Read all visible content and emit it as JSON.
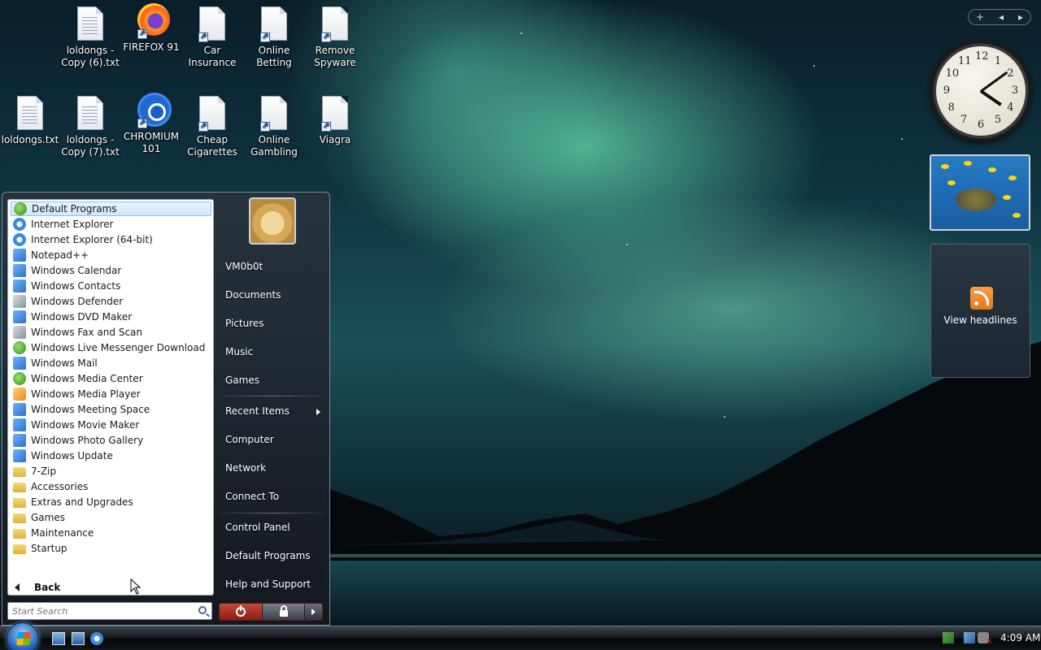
{
  "desktop": {
    "icons": [
      {
        "label": "loldongs - Copy (6).txt",
        "type": "txt"
      },
      {
        "label": "FIREFOX 91",
        "type": "firefox"
      },
      {
        "label": "Car Insurance",
        "type": "doc-shortcut"
      },
      {
        "label": "Online Betting",
        "type": "doc-shortcut"
      },
      {
        "label": "Remove Spyware",
        "type": "doc-shortcut"
      },
      {
        "label": "loldongs.txt",
        "type": "txt"
      },
      {
        "label": "loldongs - Copy (7).txt",
        "type": "txt"
      },
      {
        "label": "CHROMIUM 101",
        "type": "chromium"
      },
      {
        "label": "Cheap Cigarettes",
        "type": "doc-shortcut"
      },
      {
        "label": "Online Gambling",
        "type": "doc-shortcut"
      },
      {
        "label": "Viagra",
        "type": "doc-shortcut"
      }
    ]
  },
  "gadgets": {
    "bar": {
      "add": "+",
      "prev": "◂",
      "next": "▸"
    },
    "clock": {
      "numerals": [
        "12",
        "1",
        "2",
        "3",
        "4",
        "5",
        "6",
        "7",
        "8",
        "9",
        "10",
        "11"
      ],
      "hour": 4,
      "minute": 9
    },
    "feed": {
      "label": "View headlines",
      "icon": "rss-icon"
    }
  },
  "start_menu": {
    "programs": [
      {
        "label": "Default Programs",
        "icon": "green",
        "highlighted": true
      },
      {
        "label": "Internet Explorer",
        "icon": "ie"
      },
      {
        "label": "Internet Explorer (64-bit)",
        "icon": "ie"
      },
      {
        "label": "Notepad++",
        "icon": "app"
      },
      {
        "label": "Windows Calendar",
        "icon": "app"
      },
      {
        "label": "Windows Contacts",
        "icon": "app"
      },
      {
        "label": "Windows Defender",
        "icon": "grey"
      },
      {
        "label": "Windows DVD Maker",
        "icon": "app"
      },
      {
        "label": "Windows Fax and Scan",
        "icon": "grey"
      },
      {
        "label": "Windows Live Messenger Download",
        "icon": "green"
      },
      {
        "label": "Windows Mail",
        "icon": "app"
      },
      {
        "label": "Windows Media Center",
        "icon": "green"
      },
      {
        "label": "Windows Media Player",
        "icon": "orange"
      },
      {
        "label": "Windows Meeting Space",
        "icon": "app"
      },
      {
        "label": "Windows Movie Maker",
        "icon": "app"
      },
      {
        "label": "Windows Photo Gallery",
        "icon": "app"
      },
      {
        "label": "Windows Update",
        "icon": "app"
      },
      {
        "label": "7-Zip",
        "icon": "folder"
      },
      {
        "label": "Accessories",
        "icon": "folder"
      },
      {
        "label": "Extras and Upgrades",
        "icon": "folder"
      },
      {
        "label": "Games",
        "icon": "folder"
      },
      {
        "label": "Maintenance",
        "icon": "folder"
      },
      {
        "label": "Startup",
        "icon": "folder"
      }
    ],
    "back_label": "Back",
    "search": {
      "placeholder": "Start Search"
    },
    "user": {
      "name": "VM0b0t"
    },
    "right_items": {
      "documents": "Documents",
      "pictures": "Pictures",
      "music": "Music",
      "games": "Games",
      "recent_items": "Recent Items",
      "computer": "Computer",
      "network": "Network",
      "connect_to": "Connect To",
      "control_panel": "Control Panel",
      "default_programs": "Default Programs",
      "help_support": "Help and Support"
    }
  },
  "taskbar": {
    "clock": "4:09 AM"
  }
}
